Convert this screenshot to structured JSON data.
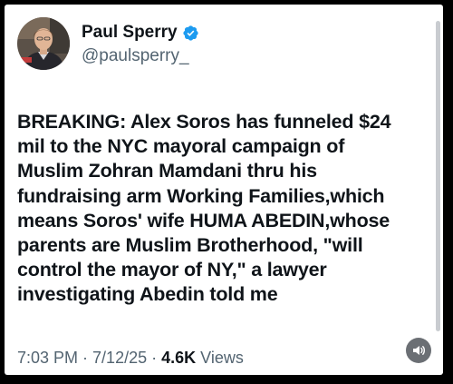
{
  "author": {
    "display_name": "Paul Sperry",
    "handle": "@paulsperry_",
    "verified": true,
    "verified_color": "#1d9bf0",
    "avatar_icon": "profile-photo"
  },
  "tweet": {
    "lines": [
      "BREAKING: Alex Soros has funneled $24",
      "mil to the NYC mayoral campaign of",
      "Muslim Zohran Mamdani thru his",
      "fundraising arm Working Families,which",
      "means Soros' wife HUMA ABEDIN,whose",
      "parents are Muslim Brotherhood, \"will",
      "control the mayor of NY,\" a lawyer",
      "investigating Abedin told me"
    ]
  },
  "meta": {
    "time": "7:03 PM",
    "separator": " · ",
    "date": "7/12/25",
    "views_count": "4.6K",
    "views_label": " Views"
  },
  "controls": {
    "audio_icon": "speaker-icon"
  },
  "colors": {
    "background": "#000000",
    "card": "#ffffff",
    "text_primary": "#0f1419",
    "text_secondary": "#536471"
  }
}
